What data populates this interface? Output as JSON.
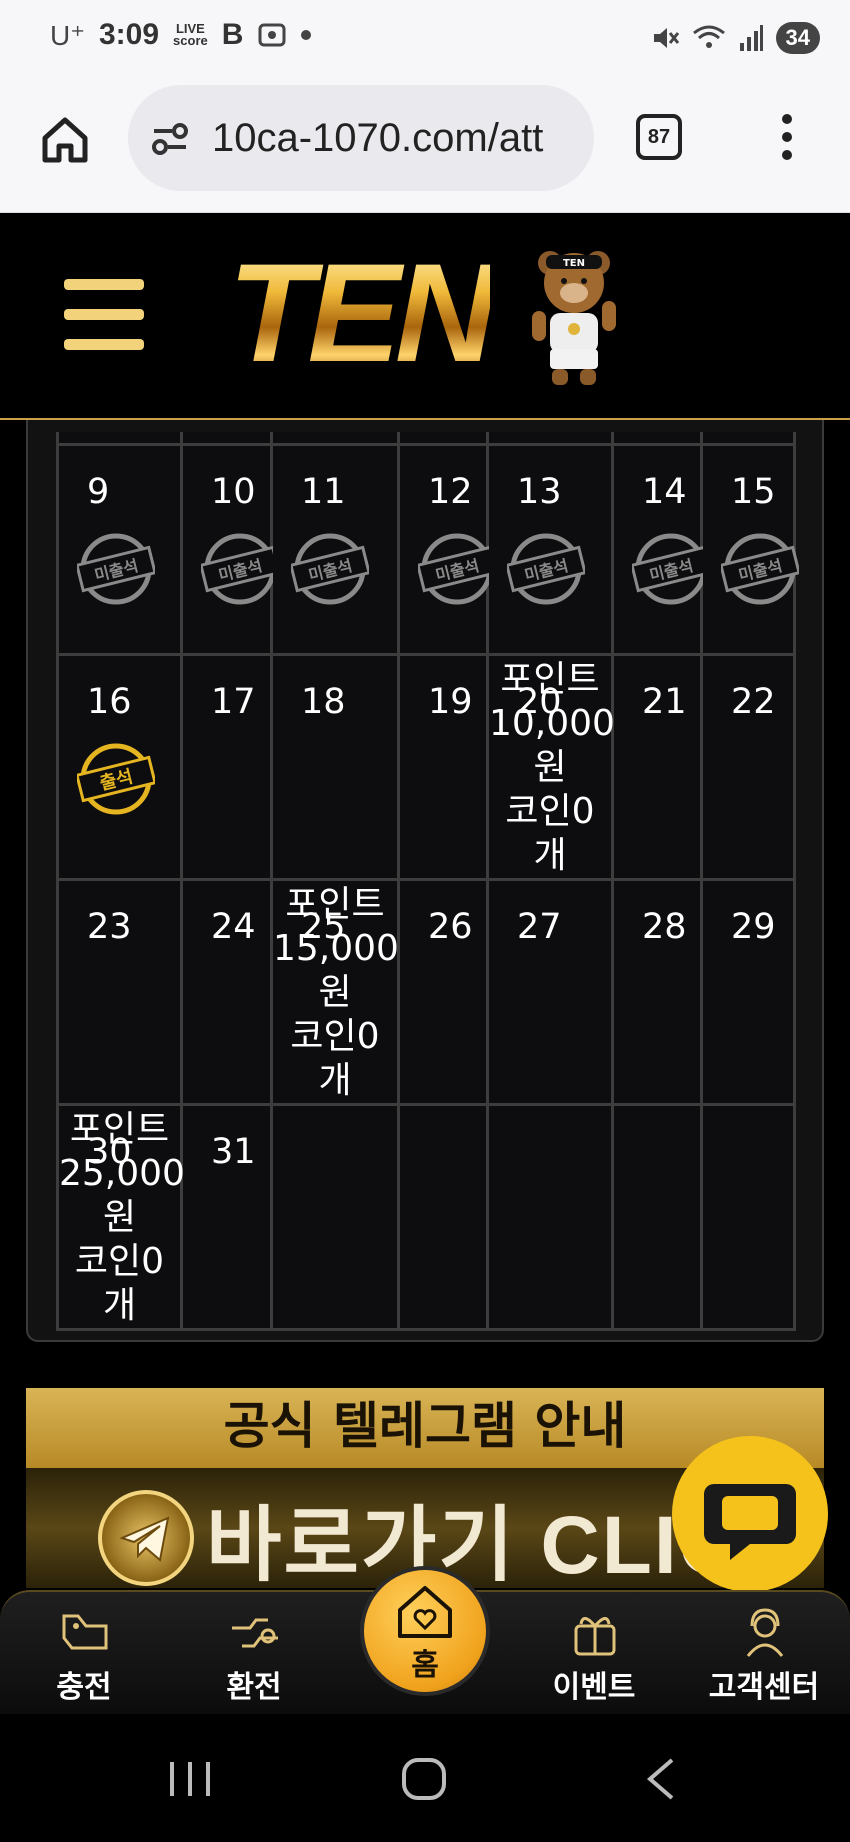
{
  "status_bar": {
    "carrier": "U⁺",
    "time": "3:09",
    "live_score_line1": "LIVE",
    "live_score_line2": "score",
    "b_app": "B",
    "battery": "34"
  },
  "browser": {
    "url": "10ca-1070.com/att",
    "tab_count": "87"
  },
  "site": {
    "logo_text": "TEN",
    "mascot_badge": "TEN"
  },
  "calendar": {
    "weeks": [
      [
        {
          "day": "9",
          "stamp": "미출석"
        },
        {
          "day": "10",
          "stamp": "미출석"
        },
        {
          "day": "11",
          "stamp": "미출석"
        },
        {
          "day": "12",
          "stamp": "미출석"
        },
        {
          "day": "13",
          "stamp": "미출석"
        },
        {
          "day": "14",
          "stamp": "미출석"
        },
        {
          "day": "15",
          "stamp": "미출석"
        }
      ],
      [
        {
          "day": "16",
          "stamp": "출석"
        },
        {
          "day": "17"
        },
        {
          "day": "18"
        },
        {
          "day": "19"
        },
        {
          "day": "20",
          "reward": [
            "포인트",
            "10,000",
            "원",
            "코인0",
            "개"
          ]
        },
        {
          "day": "21"
        },
        {
          "day": "22"
        }
      ],
      [
        {
          "day": "23"
        },
        {
          "day": "24"
        },
        {
          "day": "25",
          "reward": [
            "포인트",
            "15,000",
            "원",
            "코인0",
            "개"
          ]
        },
        {
          "day": "26"
        },
        {
          "day": "27"
        },
        {
          "day": "28"
        },
        {
          "day": "29"
        }
      ],
      [
        {
          "day": "30",
          "reward": [
            "포인트",
            "25,000",
            "원",
            "코인0",
            "개"
          ]
        },
        {
          "day": "31"
        },
        {
          "day": ""
        },
        {
          "day": ""
        },
        {
          "day": ""
        },
        {
          "day": ""
        },
        {
          "day": ""
        }
      ]
    ]
  },
  "banner": {
    "title": "공식 텔레그램 안내",
    "cta": "바로가기 CLICK"
  },
  "bottom_nav": {
    "charge": "충전",
    "exchange": "환전",
    "home": "홈",
    "event": "이벤트",
    "support": "고객센터"
  },
  "colors": {
    "accent_gold": "#f0b93a",
    "chat_yellow": "#f5c21b",
    "grid_border": "#3d3d3d"
  }
}
